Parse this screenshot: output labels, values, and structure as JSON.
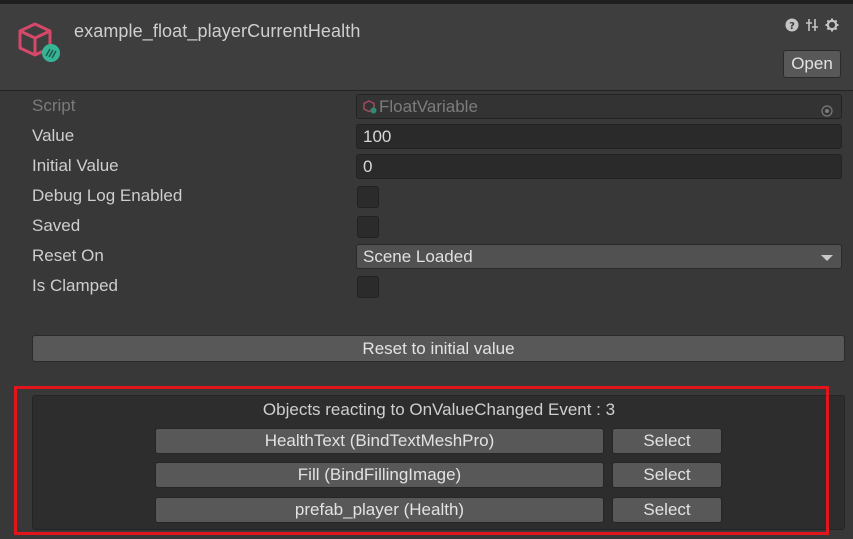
{
  "header": {
    "title": "example_float_playerCurrentHealth",
    "open_label": "Open",
    "icons": [
      "help-icon",
      "preset-icon",
      "gear-icon"
    ],
    "asset_icon": "cube-asset-icon"
  },
  "properties": {
    "script": {
      "label": "Script",
      "value": "FloatVariable"
    },
    "value": {
      "label": "Value",
      "value": "100"
    },
    "initial_value": {
      "label": "Initial Value",
      "value": "0"
    },
    "debug_log": {
      "label": "Debug Log Enabled",
      "checked": false
    },
    "saved": {
      "label": "Saved",
      "checked": false
    },
    "reset_on": {
      "label": "Reset On",
      "value": "Scene Loaded"
    },
    "is_clamped": {
      "label": "Is Clamped",
      "checked": false
    }
  },
  "reset_button_label": "Reset to initial value",
  "events": {
    "title": "Objects reacting to OnValueChanged Event : 3",
    "items": [
      {
        "name": "HealthText  (BindTextMeshPro)",
        "select": "Select"
      },
      {
        "name": "Fill  (BindFillingImage)",
        "select": "Select"
      },
      {
        "name": "prefab_player  (Health)",
        "select": "Select"
      }
    ]
  },
  "colors": {
    "background": "#383838",
    "highlight": "#e2141c",
    "asset_icon_primary": "#d5486a",
    "asset_icon_accent": "#36b596"
  }
}
